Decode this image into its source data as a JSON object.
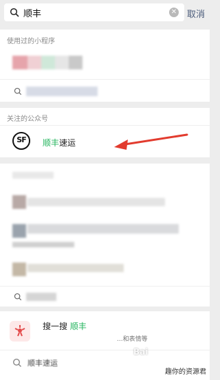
{
  "search": {
    "query": "顺丰",
    "cancel_label": "取消"
  },
  "mini_programs": {
    "section_title": "使用过的小程序"
  },
  "official_accounts": {
    "section_title": "关注的公众号",
    "item": {
      "name_highlight": "顺丰",
      "name_rest": "速运",
      "logo_text": "SF"
    }
  },
  "sousou": {
    "title_prefix": "搜一搜",
    "title_highlight": "顺丰",
    "subtitle": "...和表情等"
  },
  "bottom_query": "顺丰速运",
  "watermark": {
    "left": "Bai",
    "right": "趣你的资源君"
  },
  "colors": {
    "highlight": "#23b45d",
    "arrow": "#e23b2e",
    "background": "#ededed"
  }
}
